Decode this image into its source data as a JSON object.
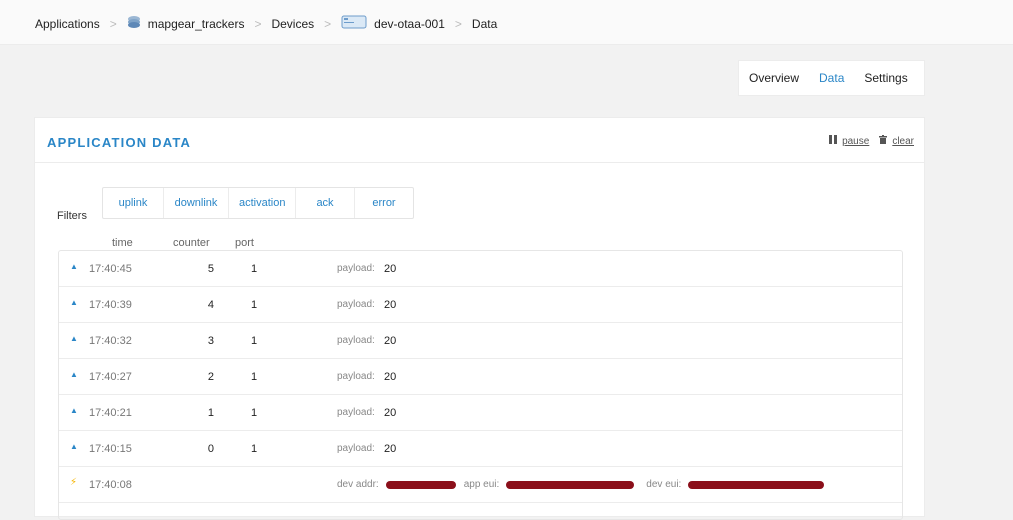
{
  "breadcrumb": {
    "applications": "Applications",
    "app": "mapgear_trackers",
    "devices": "Devices",
    "device": "dev-otaa-001",
    "data": "Data",
    "separator": ">"
  },
  "tabs": [
    {
      "label": "Overview",
      "active": false
    },
    {
      "label": "Data",
      "active": true
    },
    {
      "label": "Settings",
      "active": false
    }
  ],
  "card": {
    "title": "APPLICATION DATA",
    "pause_label": "pause",
    "clear_label": "clear"
  },
  "filters": {
    "label": "Filters",
    "items": [
      "uplink",
      "downlink",
      "activation",
      "ack",
      "error"
    ]
  },
  "columns": {
    "time": "time",
    "counter": "counter",
    "port": "port"
  },
  "rows": [
    {
      "time": "17:40:45",
      "counter": "5",
      "port": "1",
      "payload_label": "payload:",
      "payload": "20"
    },
    {
      "time": "17:40:39",
      "counter": "4",
      "port": "1",
      "payload_label": "payload:",
      "payload": "20"
    },
    {
      "time": "17:40:32",
      "counter": "3",
      "port": "1",
      "payload_label": "payload:",
      "payload": "20"
    },
    {
      "time": "17:40:27",
      "counter": "2",
      "port": "1",
      "payload_label": "payload:",
      "payload": "20"
    },
    {
      "time": "17:40:21",
      "counter": "1",
      "port": "1",
      "payload_label": "payload:",
      "payload": "20"
    },
    {
      "time": "17:40:15",
      "counter": "0",
      "port": "1",
      "payload_label": "payload:",
      "payload": "20"
    }
  ],
  "activation_row": {
    "time": "17:40:08",
    "dev_addr_label": "dev addr:",
    "app_eui_label": "app eui:",
    "dev_eui_label": "dev eui:"
  },
  "colors": {
    "accent": "#2a86c7",
    "activation": "#f5b400",
    "redaction": "#8b0f1a"
  },
  "icons": {
    "uplink": "triangle-up-icon",
    "activation": "lightning-icon",
    "pause": "pause-icon",
    "clear": "trash-icon",
    "app": "stack-icon",
    "device": "device-icon"
  }
}
